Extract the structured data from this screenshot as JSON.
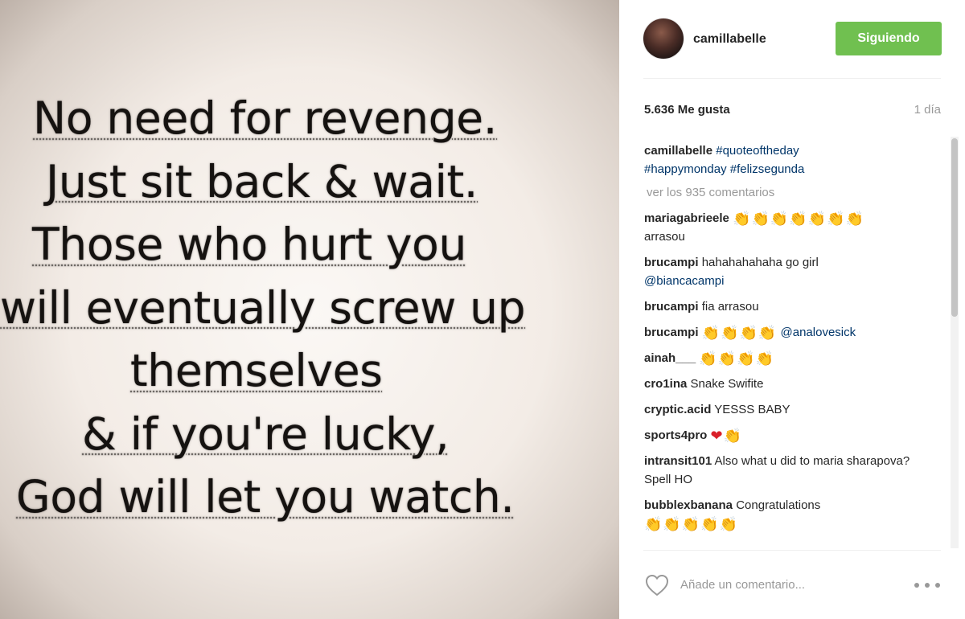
{
  "post": {
    "quote_lines": [
      [
        "No need for revenge."
      ],
      [
        "Just sit back & wait."
      ],
      [
        "Those who hurt you"
      ],
      [
        "will eventually screw up"
      ],
      [
        "themselves"
      ],
      [
        "& if you're lucky,"
      ],
      [
        "God will let you watch."
      ]
    ]
  },
  "header": {
    "username": "camillabelle",
    "follow_label": "Siguiendo",
    "follow_color": "#70c050"
  },
  "stats": {
    "likes": "5.636 Me gusta",
    "time": "1 día"
  },
  "caption": {
    "user": "camillabelle",
    "tag1": "#quoteoftheday",
    "tag2": "#happymonday",
    "tag3": "#felizsegunda"
  },
  "view_all": "ver los 935 comentarios",
  "comments": [
    {
      "user": "mariagabrieele",
      "emoji": "👏👏👏👏👏👏👏",
      "text": "arrasou"
    },
    {
      "user": "brucampi",
      "text": "hahahahahaha go girl",
      "tag": "@biancacampi"
    },
    {
      "user": "brucampi",
      "text": "fia arrasou"
    },
    {
      "user": "brucampi",
      "emoji": "👏👏👏👏",
      "tag": "@analovesick"
    },
    {
      "user": "ainah___",
      "emoji": "👏👏👏👏"
    },
    {
      "user": "cro1ina",
      "text": "Snake Swifite"
    },
    {
      "user": "cryptic.acid",
      "text": "YESSS BABY"
    },
    {
      "user": "sports4pro",
      "emoji_heart": "❤",
      "emoji": "👏"
    },
    {
      "user": "intransit101",
      "text": "Also what u did to maria sharapova? Spell HO"
    },
    {
      "user": "bubblexbanana",
      "text": "Congratulations",
      "emoji": "👏👏👏👏👏"
    }
  ],
  "footer": {
    "placeholder": "Añade un comentario...",
    "link_color": "#003569"
  }
}
